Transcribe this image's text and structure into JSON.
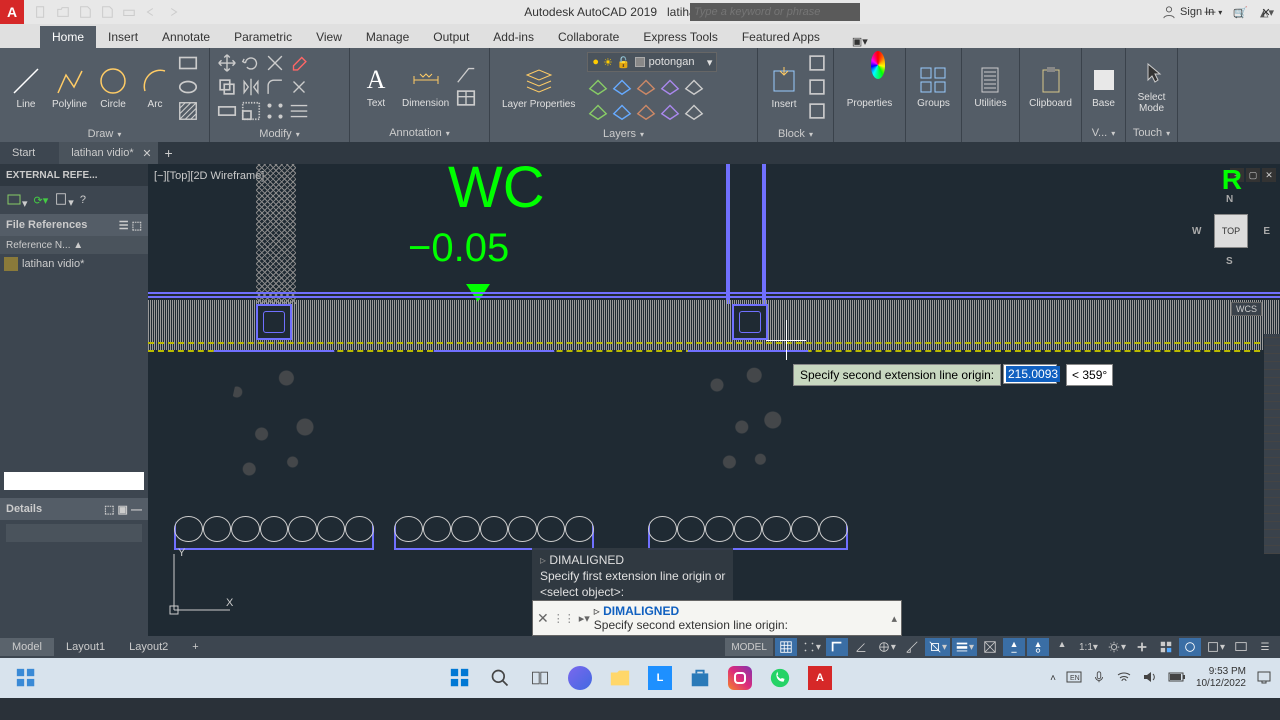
{
  "app": {
    "name": "Autodesk AutoCAD 2019",
    "doc": "latihan vidio.dwg",
    "logo": "A"
  },
  "search": {
    "placeholder": "Type a keyword or phrase"
  },
  "signin": {
    "label": "Sign In"
  },
  "tabs": [
    "Home",
    "Insert",
    "Annotate",
    "Parametric",
    "View",
    "Manage",
    "Output",
    "Add-ins",
    "Collaborate",
    "Express Tools",
    "Featured Apps"
  ],
  "active_tab": "Home",
  "panels": {
    "draw": {
      "label": "Draw",
      "tools": [
        "Line",
        "Polyline",
        "Circle",
        "Arc"
      ]
    },
    "modify": {
      "label": "Modify"
    },
    "annotation": {
      "label": "Annotation",
      "tools": [
        "Text",
        "Dimension"
      ]
    },
    "layers": {
      "label": "Layers",
      "current": "potongan",
      "panel": "Layer Properties"
    },
    "block": {
      "label": "Block",
      "insert": "Insert"
    },
    "props": {
      "label": "Properties"
    },
    "groups": {
      "label": "Groups"
    },
    "utils": {
      "label": "Utilities"
    },
    "clip": {
      "label": "Clipboard"
    },
    "view": {
      "label": "V...",
      "base": "Base"
    },
    "touch": {
      "label": "Touch",
      "select": "Select Mode"
    }
  },
  "doc_tabs": [
    "Start",
    "latihan vidio*"
  ],
  "side": {
    "title": "EXTERNAL REFE...",
    "section": "File References",
    "colhead": "Reference N... ▲",
    "item": "latihan vidio*",
    "details": "Details"
  },
  "canvas": {
    "view_label": "[−][Top][2D Wireframe]",
    "wc": "WC",
    "level": "−0.05",
    "viewcube": {
      "face": "TOP",
      "N": "N",
      "S": "S",
      "E": "E",
      "W": "W",
      "wcs": "WCS"
    }
  },
  "dyn": {
    "prompt": "Specify second extension line origin:",
    "value": "215.0093",
    "angle_prefix": "<",
    "angle": "359°"
  },
  "cmd_history": {
    "l1": "DIMALIGNED",
    "l2": "Specify first extension line origin or",
    "l3": "<select object>:"
  },
  "cmd": {
    "cmd": "DIMALIGNED",
    "prompt": "Specify second extension line origin:"
  },
  "layout_tabs": [
    "Model",
    "Layout1",
    "Layout2"
  ],
  "status": {
    "model": "MODEL",
    "scale": "1:1"
  },
  "taskbar": {
    "time": "9:53 PM",
    "date": "10/12/2022"
  }
}
